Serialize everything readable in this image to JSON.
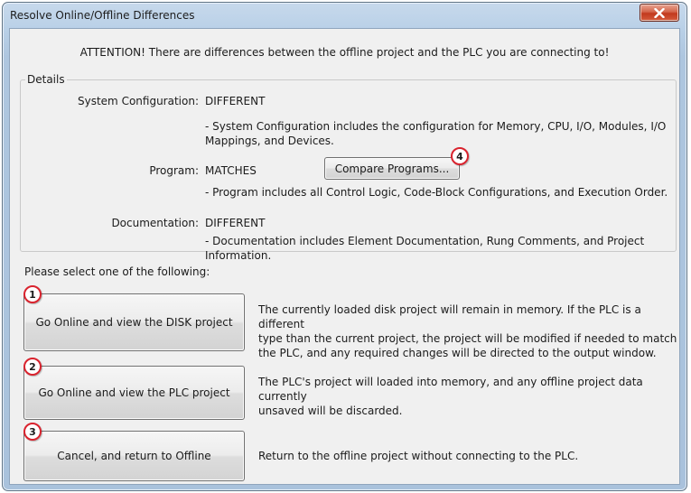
{
  "window": {
    "title": "Resolve Online/Offline Differences",
    "close_icon": "close-x-icon"
  },
  "attention": "ATTENTION! There are differences between the offline project and the PLC you are connecting to!",
  "details": {
    "legend": "Details",
    "system": {
      "label": "System Configuration:",
      "value": "DIFFERENT",
      "description_line1": "- System Configuration includes the configuration for Memory, CPU, I/O, Modules, I/O",
      "description_line2": "Mappings, and Devices."
    },
    "program": {
      "label": "Program:",
      "value": "MATCHES",
      "compare_button": "Compare Programs...",
      "badge": "4",
      "description": "- Program includes all Control Logic, Code-Block Configurations, and Execution Order."
    },
    "documentation": {
      "label": "Documentation:",
      "value": "DIFFERENT",
      "description": "- Documentation includes Element Documentation, Rung Comments, and Project Information."
    }
  },
  "prompt": "Please select one of the following:",
  "options": [
    {
      "badge": "1",
      "button": "Go Online and view the DISK project",
      "description_lines": [
        "The currently loaded disk project will remain in memory. If the PLC is a different",
        "type than the current project, the project will be modified if needed to match",
        "the PLC, and any required changes will be directed to the output window."
      ]
    },
    {
      "badge": "2",
      "button": "Go Online and view the PLC project",
      "description_lines": [
        "The PLC's project will loaded into memory, and any offline project data currently",
        "unsaved will be discarded."
      ]
    },
    {
      "badge": "3",
      "button": "Cancel, and return to Offline",
      "description_lines": [
        "Return to the offline project without connecting to the PLC."
      ]
    }
  ],
  "colors": {
    "badge_border": "#d9232e",
    "close_button": "#c2391e",
    "frame": "#b9d0e7"
  }
}
